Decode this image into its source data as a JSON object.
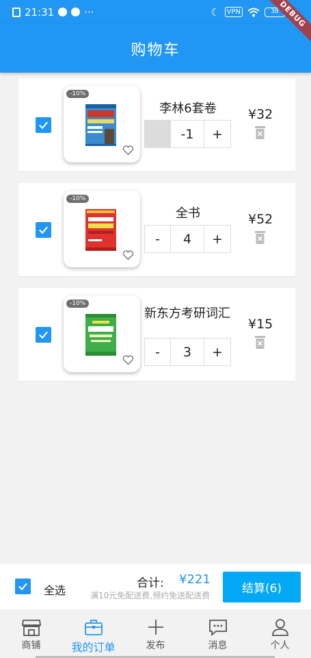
{
  "status_bar": {
    "time": "21:31",
    "vpn": "VPN",
    "battery": "38",
    "debug": "DEBUG",
    "dots": "···"
  },
  "app_bar": {
    "title": "购物车"
  },
  "cart_items": [
    {
      "title": "李林6套卷",
      "discount": "-10%",
      "quantity": "-1",
      "minus_label": "",
      "plus_label": "+",
      "price": "¥32",
      "checked": true,
      "minus_disabled": true
    },
    {
      "title": "全书",
      "discount": "-10%",
      "quantity": "4",
      "minus_label": "-",
      "plus_label": "+",
      "price": "¥52",
      "checked": true,
      "minus_disabled": false
    },
    {
      "title": "新东方考研词汇",
      "discount": "-10%",
      "quantity": "3",
      "minus_label": "-",
      "plus_label": "+",
      "price": "¥15",
      "checked": true,
      "minus_disabled": false
    }
  ],
  "checkout": {
    "select_all_label": "全选",
    "total_label": "合计:",
    "total_amount": "¥221",
    "shipping_note": "满10元免配送费,预约免送配送费",
    "pay_button": "结算(6)"
  },
  "bottom_nav": {
    "tabs": [
      {
        "label": "商铺",
        "icon": "shop-icon",
        "active": false
      },
      {
        "label": "我的订单",
        "icon": "briefcase-icon",
        "active": true
      },
      {
        "label": "发布",
        "icon": "plus-icon",
        "active": false
      },
      {
        "label": "消息",
        "icon": "message-icon",
        "active": false
      },
      {
        "label": "个人",
        "icon": "person-icon",
        "active": false
      }
    ]
  },
  "colors": {
    "primary": "#2196f3",
    "pay_button": "#03a9f4",
    "background": "#f2f2f2"
  }
}
